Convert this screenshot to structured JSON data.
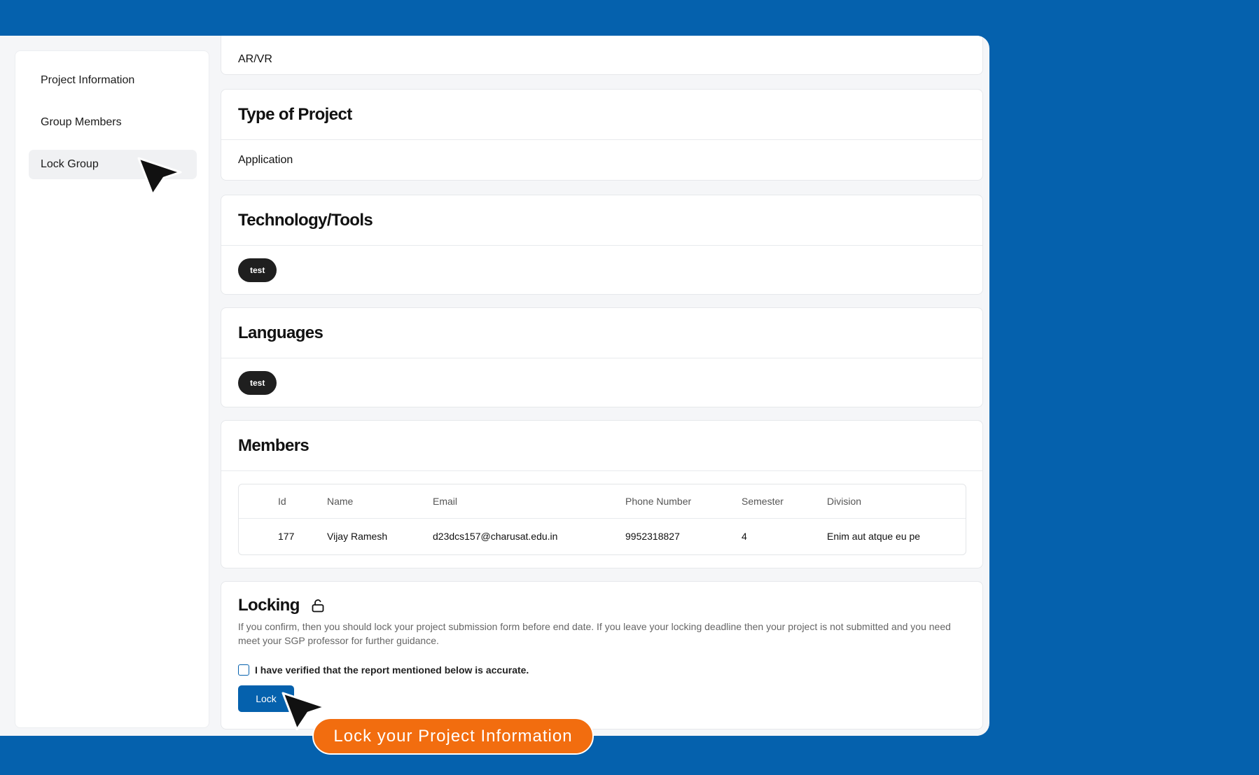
{
  "sidebar": {
    "items": [
      {
        "label": "Project Information"
      },
      {
        "label": "Group Members"
      },
      {
        "label": "Lock Group"
      }
    ]
  },
  "domain_card": {
    "value": "AR/VR"
  },
  "type_card": {
    "title": "Type of Project",
    "value": "Application"
  },
  "tech_card": {
    "title": "Technology/Tools",
    "chips": [
      "test"
    ]
  },
  "lang_card": {
    "title": "Languages",
    "chips": [
      "test"
    ]
  },
  "members": {
    "title": "Members",
    "columns": [
      "Id",
      "Name",
      "Email",
      "Phone Number",
      "Semester",
      "Division"
    ],
    "rows": [
      [
        "177",
        "Vijay Ramesh",
        "d23dcs157@charusat.edu.in",
        "9952318827",
        "4",
        "Enim aut atque eu pe"
      ]
    ]
  },
  "locking": {
    "title": "Locking",
    "icon": "unlock-icon",
    "description": "If you confirm, then you should lock your project submission form before end date. If you leave your locking deadline then your project is not submitted and you need meet your SGP professor for further guidance.",
    "checkbox_label": "I have verified that the report mentioned below is accurate.",
    "checked": false,
    "button_label": "Lock"
  },
  "callout": {
    "text": "Lock your Project Information"
  },
  "colors": {
    "brand": "#0561ad",
    "callout": "#f26d0f",
    "chip": "#1f1f1f"
  }
}
